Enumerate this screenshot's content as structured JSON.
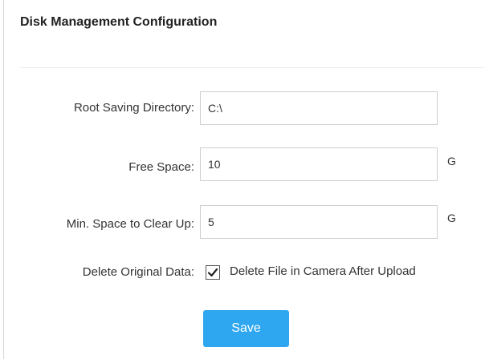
{
  "panel": {
    "title": "Disk Management Configuration"
  },
  "form": {
    "root_dir": {
      "label": "Root Saving Directory:",
      "value": "C:\\"
    },
    "free_space": {
      "label": "Free Space:",
      "value": "10",
      "unit": "G"
    },
    "min_clear": {
      "label": "Min. Space to Clear Up:",
      "value": "5",
      "unit": "G"
    },
    "delete_original": {
      "label": "Delete Original Data:",
      "checkbox_label": "Delete File in Camera After Upload",
      "checked": true
    },
    "save_label": "Save"
  },
  "colors": {
    "button": "#2ea7f0",
    "border": "#cfcfcf"
  }
}
